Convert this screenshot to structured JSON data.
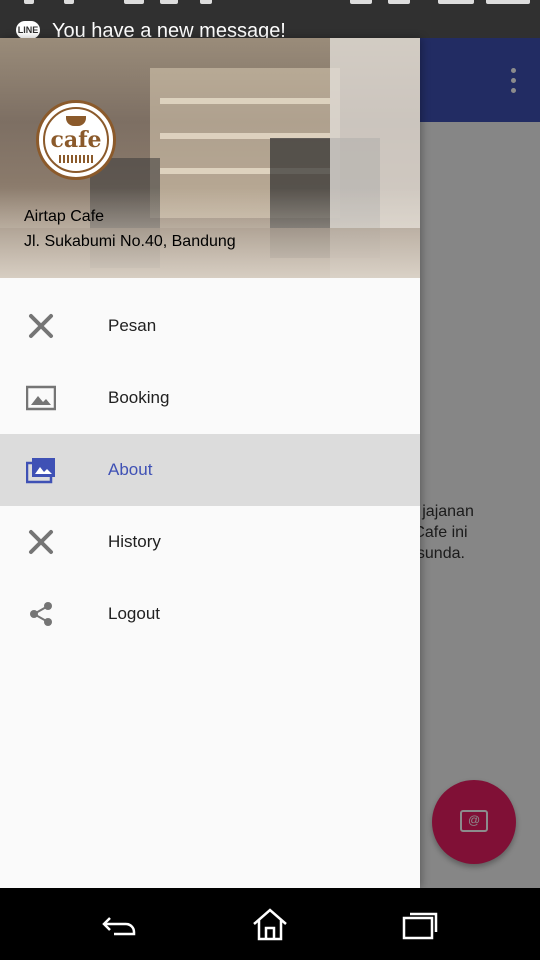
{
  "status_bar": {
    "notification_app": "LINE",
    "notification_text": "You have a new message!"
  },
  "drawer": {
    "header": {
      "logo_text": "cafe",
      "title": "Airtap Cafe",
      "address": "Jl. Sukabumi No.40, Bandung"
    },
    "items": [
      {
        "label": "Pesan",
        "icon": "tools-icon",
        "active": false
      },
      {
        "label": "Booking",
        "icon": "image-icon",
        "active": false
      },
      {
        "label": "About",
        "icon": "gallery-icon",
        "active": true
      },
      {
        "label": "History",
        "icon": "tools-icon",
        "active": false
      },
      {
        "label": "Logout",
        "icon": "share-icon",
        "active": false
      }
    ]
  },
  "background": {
    "body_lines": [
      "an jajanan",
      "p Cafe ini",
      "al sunda."
    ]
  },
  "colors": {
    "primary": "#3f51b5",
    "accent": "#e91e63",
    "active_item_bg": "#dcdcdc",
    "drawer_bg": "#fafafa"
  },
  "navbar": {
    "buttons": [
      "back-icon",
      "home-icon",
      "recents-icon"
    ]
  }
}
